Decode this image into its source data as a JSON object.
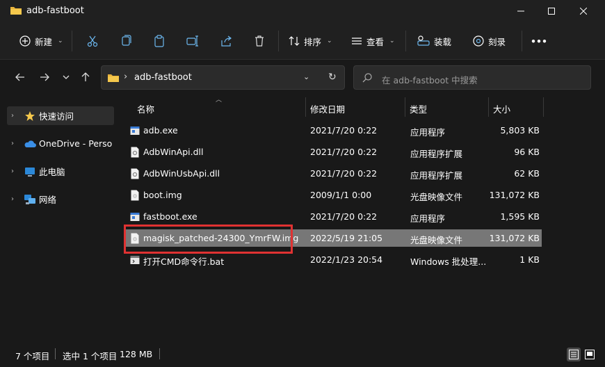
{
  "window": {
    "title": "adb-fastboot"
  },
  "toolbar": {
    "new_label": "新建",
    "sort_label": "排序",
    "view_label": "查看",
    "mount_label": "装载",
    "burn_label": "刻录",
    "more_label": "•••"
  },
  "address": {
    "path": "adb-fastboot"
  },
  "search": {
    "placeholder": "在 adb-fastboot 中搜索"
  },
  "sidebar": {
    "items": [
      {
        "label": "快速访问",
        "icon": "star-icon"
      },
      {
        "label": "OneDrive - Personal",
        "icon": "cloud-icon"
      },
      {
        "label": "此电脑",
        "icon": "monitor-icon"
      },
      {
        "label": "网络",
        "icon": "network-icon"
      }
    ]
  },
  "columns": {
    "name": "名称",
    "modified": "修改日期",
    "type": "类型",
    "size": "大小"
  },
  "files": [
    {
      "name": "adb.exe",
      "modified": "2021/7/20 0:22",
      "type": "应用程序",
      "size": "5,803 KB",
      "icon": "exe-icon"
    },
    {
      "name": "AdbWinApi.dll",
      "modified": "2021/7/20 0:22",
      "type": "应用程序扩展",
      "size": "96 KB",
      "icon": "dll-icon"
    },
    {
      "name": "AdbWinUsbApi.dll",
      "modified": "2021/7/20 0:22",
      "type": "应用程序扩展",
      "size": "62 KB",
      "icon": "dll-icon"
    },
    {
      "name": "boot.img",
      "modified": "2009/1/1 0:00",
      "type": "光盘映像文件",
      "size": "131,072 KB",
      "icon": "img-icon"
    },
    {
      "name": "fastboot.exe",
      "modified": "2021/7/20 0:22",
      "type": "应用程序",
      "size": "1,595 KB",
      "icon": "exe-icon"
    },
    {
      "name": "magisk_patched-24300_YmrFW.img",
      "modified": "2022/5/19 21:05",
      "type": "光盘映像文件",
      "size": "131,072 KB",
      "icon": "img-icon"
    },
    {
      "name": "打开CMD命令行.bat",
      "modified": "2022/1/23 20:54",
      "type": "Windows 批处理...",
      "size": "1 KB",
      "icon": "bat-icon"
    }
  ],
  "status": {
    "count": "7 个项目",
    "selected": "选中 1 个项目",
    "size": "128 MB"
  },
  "colors": {
    "folder": "#e8b33c",
    "selection": "#777777",
    "highlight": "#e03232"
  }
}
